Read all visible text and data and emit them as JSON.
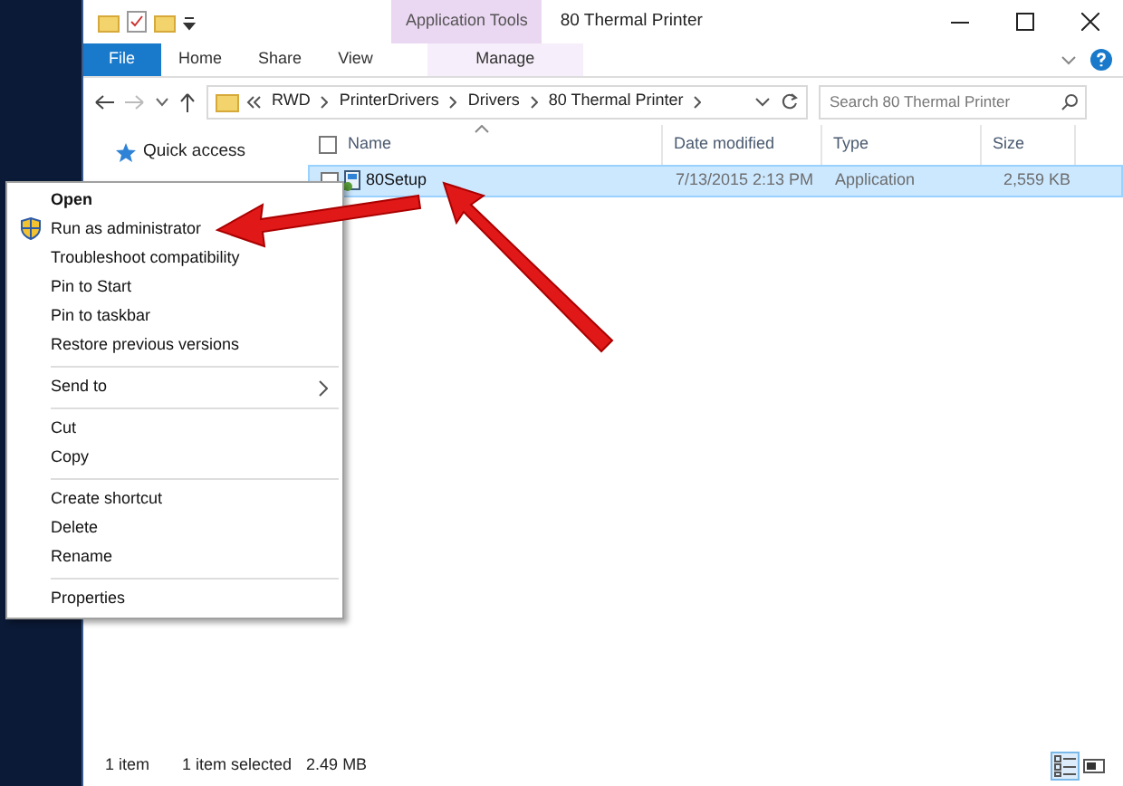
{
  "window": {
    "title": "80 Thermal Printer",
    "context_group": "Application Tools"
  },
  "ribbon_tabs": [
    {
      "label": "File",
      "kind": "file",
      "selected": false
    },
    {
      "label": "Home",
      "kind": "plain",
      "selected": false
    },
    {
      "label": "Share",
      "kind": "plain",
      "selected": false
    },
    {
      "label": "View",
      "kind": "plain",
      "selected": false
    },
    {
      "label": "Manage",
      "kind": "context",
      "selected": false
    }
  ],
  "address_bar": {
    "crumbs": [
      "RWD",
      "PrinterDrivers",
      "Drivers",
      "80 Thermal Printer"
    ]
  },
  "search": {
    "placeholder": "Search 80 Thermal Printer"
  },
  "navigation": [
    {
      "label": "Quick access"
    }
  ],
  "select_all": {
    "checked": false
  },
  "columns": [
    "Name",
    "Date modified",
    "Type",
    "Size"
  ],
  "rows": [
    {
      "name": "80Setup",
      "date_modified": "7/13/2015 2:13 PM",
      "type": "Application",
      "size": "2,559 KB",
      "selected": true
    }
  ],
  "context_menu": [
    [
      {
        "label": "Open",
        "kind": "default"
      },
      {
        "label": "Run as administrator",
        "kind": "shield"
      },
      {
        "label": "Troubleshoot compatibility",
        "kind": "plain"
      },
      {
        "label": "Pin to Start",
        "kind": "plain"
      },
      {
        "label": "Pin to taskbar",
        "kind": "plain"
      },
      {
        "label": "Restore previous versions",
        "kind": "plain"
      }
    ],
    [
      {
        "label": "Send to",
        "kind": "submenu"
      }
    ],
    [
      {
        "label": "Cut",
        "kind": "plain"
      },
      {
        "label": "Copy",
        "kind": "plain"
      }
    ],
    [
      {
        "label": "Create shortcut",
        "kind": "plain"
      },
      {
        "label": "Delete",
        "kind": "plain"
      },
      {
        "label": "Rename",
        "kind": "plain"
      }
    ],
    [
      {
        "label": "Properties",
        "kind": "plain"
      }
    ]
  ],
  "status_bar": {
    "item_count": "1 item",
    "selection": "1 item selected",
    "selection_size": "2.49 MB"
  },
  "view_buttons": [
    {
      "kind": "details",
      "selected": true
    },
    {
      "kind": "large",
      "selected": false
    }
  ]
}
